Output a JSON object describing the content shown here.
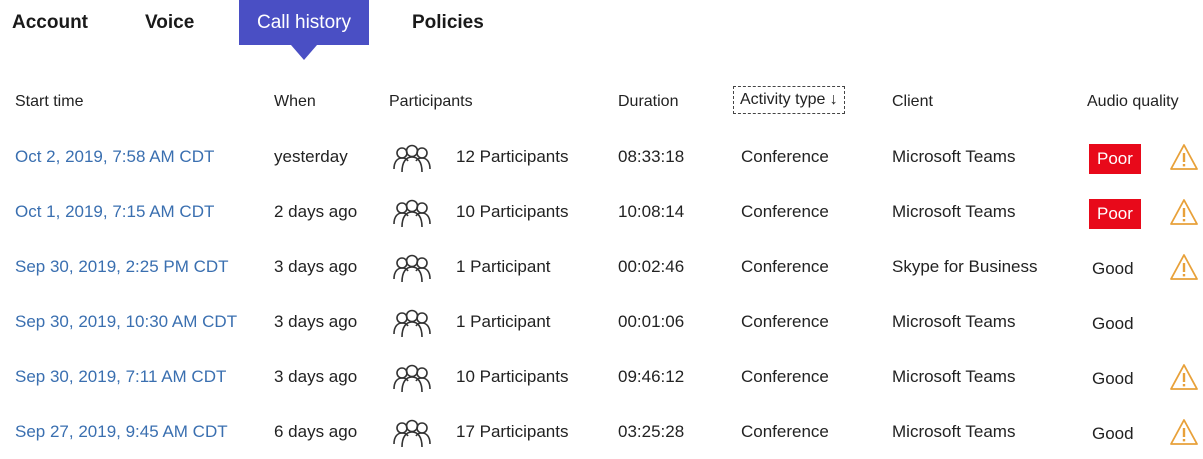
{
  "tabs": [
    {
      "label": "Account",
      "active": false
    },
    {
      "label": "Voice",
      "active": false
    },
    {
      "label": "Call history",
      "active": true
    },
    {
      "label": "Policies",
      "active": false
    }
  ],
  "columns": {
    "start_time": "Start time",
    "when": "When",
    "participants": "Participants",
    "duration": "Duration",
    "activity_type": "Activity type ↓",
    "client": "Client",
    "audio_quality": "Audio quality"
  },
  "rows": [
    {
      "start_time": "Oct 2, 2019, 7:58 AM CDT",
      "when": "yesterday",
      "participants": "12 Participants",
      "duration": "08:33:18",
      "activity_type": "Conference",
      "client": "Microsoft Teams",
      "audio_quality": "Poor",
      "warning": true
    },
    {
      "start_time": "Oct 1, 2019, 7:15 AM CDT",
      "when": "2 days ago",
      "participants": "10 Participants",
      "duration": "10:08:14",
      "activity_type": "Conference",
      "client": "Microsoft Teams",
      "audio_quality": "Poor",
      "warning": true
    },
    {
      "start_time": "Sep 30, 2019, 2:25 PM CDT",
      "when": "3 days ago",
      "participants": "1 Participant",
      "duration": "00:02:46",
      "activity_type": "Conference",
      "client": "Skype for Business",
      "audio_quality": "Good",
      "warning": true
    },
    {
      "start_time": "Sep 30, 2019, 10:30 AM CDT",
      "when": "3 days ago",
      "participants": "1 Participant",
      "duration": "00:01:06",
      "activity_type": "Conference",
      "client": "Microsoft Teams",
      "audio_quality": "Good",
      "warning": false
    },
    {
      "start_time": "Sep 30, 2019, 7:11 AM CDT",
      "when": "3 days ago",
      "participants": "10 Participants",
      "duration": "09:46:12",
      "activity_type": "Conference",
      "client": "Microsoft Teams",
      "audio_quality": "Good",
      "warning": true
    },
    {
      "start_time": "Sep 27, 2019, 9:45 AM CDT",
      "when": "6 days ago",
      "participants": "17 Participants",
      "duration": "03:25:28",
      "activity_type": "Conference",
      "client": "Microsoft Teams",
      "audio_quality": "Good",
      "warning": true
    }
  ],
  "colors": {
    "active_tab": "#4a4fc4",
    "link": "#3a6fb0",
    "poor_badge": "#e8091a",
    "warning": "#e8a13a"
  },
  "icons": {
    "participants": "people-icon",
    "warning": "warning-icon"
  }
}
